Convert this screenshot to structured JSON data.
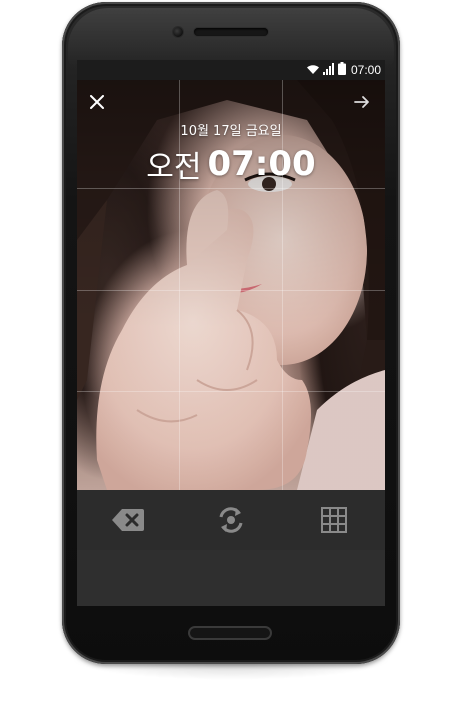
{
  "status_bar": {
    "time": "07:00",
    "icons": [
      "wifi-icon",
      "signal-icon",
      "battery-icon"
    ]
  },
  "camera_screen": {
    "date": "10월 17일 금요일",
    "time_ampm": "오전",
    "time_value": "07:00",
    "grid": "3x3",
    "top_left_icon": "close-icon",
    "top_right_icon": "arrow-right-icon"
  },
  "toolbar": {
    "icons": [
      "delete-icon",
      "switch-camera-icon",
      "grid-icon"
    ]
  },
  "colors": {
    "status_bar_bg": "#1c1c1c",
    "toolbar_bg": "#2c2c2c",
    "icon_gray": "#8a8a8a",
    "text_white": "#ffffff"
  }
}
